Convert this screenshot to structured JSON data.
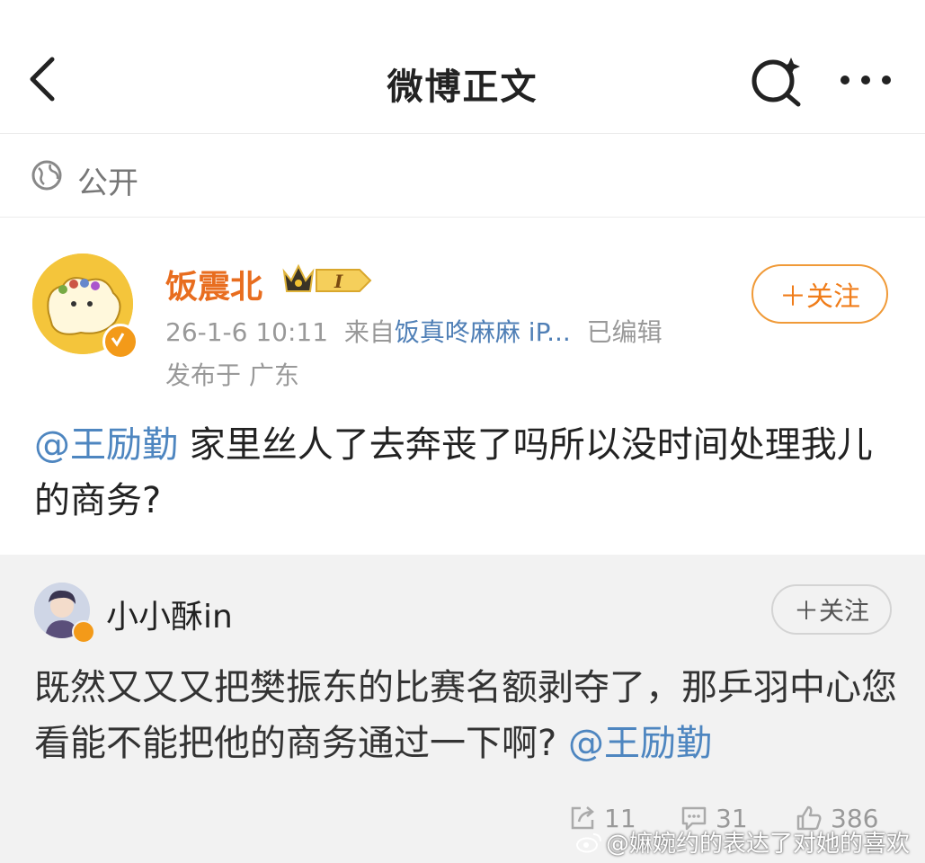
{
  "header": {
    "title": "微博正文",
    "back_icon": "chevron-left-icon",
    "search_icon": "search-sparkle-icon",
    "more_icon": "more-dots-icon"
  },
  "visibility": {
    "label": "公开",
    "icon": "globe-icon"
  },
  "post": {
    "author": "饭震北",
    "level_badge": "I",
    "follow_label": "＋关注",
    "time": "26-1-6 10:11",
    "source_prefix": "来自",
    "source": "饭真咚麻麻 iP...",
    "edited": "已编辑",
    "location": "发布于 广东",
    "mention": "@王励勤",
    "text": " 家里丝人了去奔丧了吗所以没时间处理我儿的商务?"
  },
  "repost": {
    "user": "小小酥in",
    "follow_label": "＋关注",
    "text": "既然又又又把樊振东的比赛名额剥夺了，那乒羽中心您看能不能把他的商务通过一下啊? ",
    "mention": "@王励勤"
  },
  "stats": {
    "reposts": "11",
    "comments": "31",
    "likes": "386"
  },
  "watermark": "@嫲婉约的表达了对她的喜欢",
  "colors": {
    "accent": "#f07d1a",
    "link": "#4e86c0",
    "repost_bg": "#f2f2f2"
  }
}
